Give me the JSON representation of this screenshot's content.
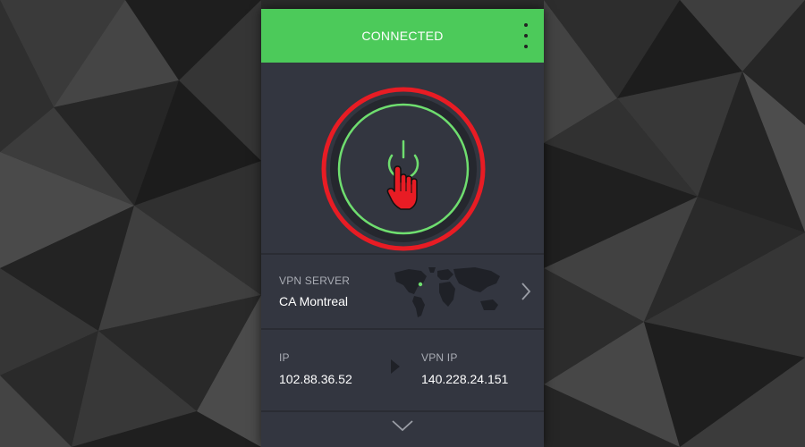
{
  "header": {
    "status_label": "CONNECTED"
  },
  "colors": {
    "status_green": "#4cca5a",
    "panel_bg": "#333640",
    "ring_green": "#6fde6f",
    "highlight_red": "#e81c24"
  },
  "icons": {
    "menu": "more-vertical-icon",
    "power": "power-icon",
    "cursor": "hand-pointer-icon",
    "map": "world-map-icon",
    "server_arrow": "chevron-right-icon",
    "ip_arrow": "triangle-right-icon",
    "expand": "chevron-down-icon"
  },
  "server": {
    "label": "VPN SERVER",
    "value": "CA Montreal"
  },
  "ip": {
    "ip_label": "IP",
    "ip_value": "102.88.36.52",
    "vpn_ip_label": "VPN IP",
    "vpn_ip_value": "140.228.24.151"
  }
}
